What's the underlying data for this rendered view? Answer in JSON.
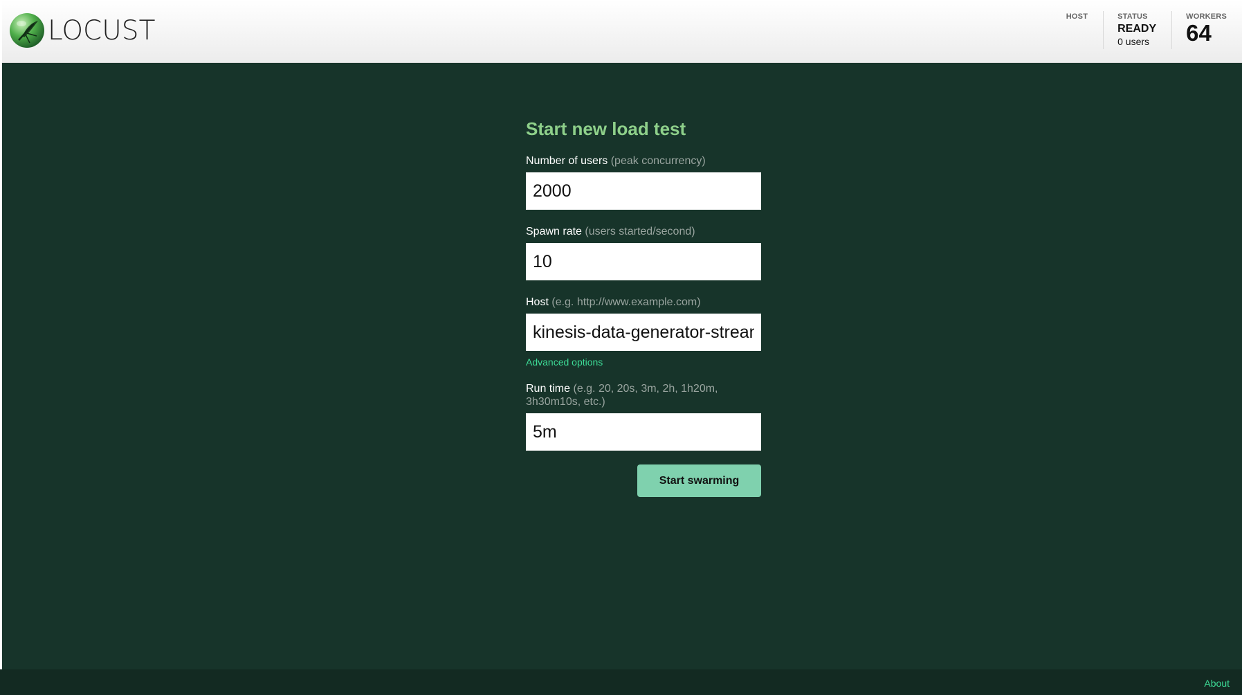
{
  "app": {
    "logo_text": "LOCUST"
  },
  "header": {
    "host": {
      "label": "HOST"
    },
    "status": {
      "label": "STATUS",
      "value": "READY",
      "users": "0 users"
    },
    "workers": {
      "label": "WORKERS",
      "value": "64"
    }
  },
  "form": {
    "title": "Start new load test",
    "users": {
      "label": "Number of users",
      "hint": "(peak concurrency)",
      "value": "2000"
    },
    "spawn_rate": {
      "label": "Spawn rate",
      "hint": "(users started/second)",
      "value": "10"
    },
    "host": {
      "label": "Host",
      "hint": "(e.g. http://www.example.com)",
      "value": "kinesis-data-generator-stream"
    },
    "advanced_link": "Advanced options",
    "run_time": {
      "label": "Run time",
      "hint": "(e.g. 20, 20s, 3m, 2h, 1h20m, 3h30m10s, etc.)",
      "value": "5m"
    },
    "submit_label": "Start swarming"
  },
  "footer": {
    "about_label": "About"
  },
  "colors": {
    "background": "#17342a",
    "title": "#8ed08a",
    "link": "#3ddc97",
    "button": "#7fd1ae"
  }
}
